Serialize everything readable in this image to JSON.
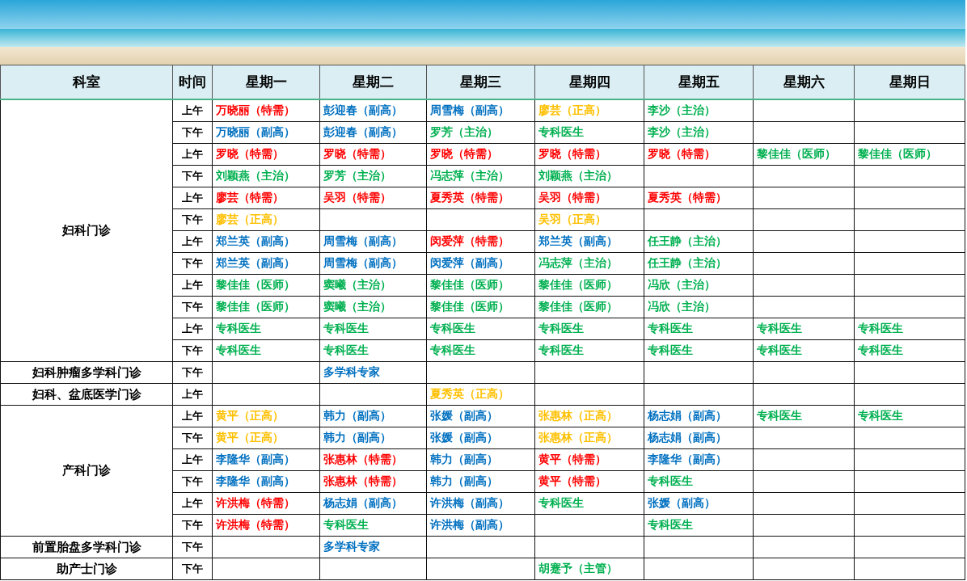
{
  "table": {
    "columns": [
      "科室",
      "时间",
      "星期一",
      "星期二",
      "星期三",
      "星期四",
      "星期五",
      "星期六",
      "星期日"
    ],
    "groups": [
      {
        "department": "妇科门诊",
        "rows": [
          {
            "time": "上午",
            "cells": [
              {
                "text": "万晓丽（特需）",
                "color": "#ff0000"
              },
              {
                "text": "彭迎春（副高）",
                "color": "#0070c0"
              },
              {
                "text": "周雪梅（副高）",
                "color": "#0070c0"
              },
              {
                "text": "廖芸（正高）",
                "color": "#ffc000"
              },
              {
                "text": "李沙（主治）",
                "color": "#00b050"
              },
              null,
              null
            ]
          },
          {
            "time": "下午",
            "cells": [
              {
                "text": "万晓丽（副高）",
                "color": "#0070c0"
              },
              {
                "text": "彭迎春（副高）",
                "color": "#0070c0"
              },
              {
                "text": "罗芳（主治）",
                "color": "#00b050"
              },
              {
                "text": "专科医生",
                "color": "#00b050"
              },
              {
                "text": "李沙（主治）",
                "color": "#00b050"
              },
              null,
              null
            ]
          },
          {
            "time": "上午",
            "cells": [
              {
                "text": "罗晓（特需）",
                "color": "#ff0000"
              },
              {
                "text": "罗晓（特需）",
                "color": "#ff0000"
              },
              {
                "text": "罗晓（特需）",
                "color": "#ff0000"
              },
              {
                "text": "罗晓（特需）",
                "color": "#ff0000"
              },
              {
                "text": "罗晓（特需）",
                "color": "#ff0000"
              },
              {
                "text": "黎佳佳（医师）",
                "color": "#00b050"
              },
              {
                "text": "黎佳佳（医师）",
                "color": "#00b050"
              }
            ]
          },
          {
            "time": "下午",
            "cells": [
              {
                "text": "刘颖燕（主治）",
                "color": "#00b050"
              },
              {
                "text": "罗芳（主治）",
                "color": "#00b050"
              },
              {
                "text": "冯志萍（主治）",
                "color": "#00b050"
              },
              {
                "text": "刘颖燕（主治）",
                "color": "#00b050"
              },
              null,
              null,
              null
            ]
          },
          {
            "time": "上午",
            "cells": [
              {
                "text": "廖芸（特需）",
                "color": "#ff0000"
              },
              {
                "text": "吴羽（特需）",
                "color": "#ff0000"
              },
              {
                "text": "夏秀英（特需）",
                "color": "#ff0000"
              },
              {
                "text": "吴羽（特需）",
                "color": "#ff0000"
              },
              {
                "text": "夏秀英（特需）",
                "color": "#ff0000"
              },
              null,
              null
            ]
          },
          {
            "time": "下午",
            "cells": [
              {
                "text": "廖芸（正高）",
                "color": "#ffc000"
              },
              null,
              null,
              {
                "text": "吴羽（正高）",
                "color": "#ffc000"
              },
              null,
              null,
              null
            ]
          },
          {
            "time": "上午",
            "cells": [
              {
                "text": "郑兰英（副高）",
                "color": "#0070c0"
              },
              {
                "text": "周雪梅（副高）",
                "color": "#0070c0"
              },
              {
                "text": "闵爱萍（特需）",
                "color": "#ff0000"
              },
              {
                "text": "郑兰英（副高）",
                "color": "#0070c0"
              },
              {
                "text": "任王静（主治）",
                "color": "#00b050"
              },
              null,
              null
            ]
          },
          {
            "time": "下午",
            "cells": [
              {
                "text": "郑兰英（副高）",
                "color": "#0070c0"
              },
              {
                "text": "周雪梅（副高）",
                "color": "#0070c0"
              },
              {
                "text": "闵爱萍（副高）",
                "color": "#0070c0"
              },
              {
                "text": "冯志萍（主治）",
                "color": "#00b050"
              },
              {
                "text": "任王静（主治）",
                "color": "#00b050"
              },
              null,
              null
            ]
          },
          {
            "time": "上午",
            "cells": [
              {
                "text": "黎佳佳（医师）",
                "color": "#00b050"
              },
              {
                "text": "窦曦（主治）",
                "color": "#00b050"
              },
              {
                "text": "黎佳佳（医师）",
                "color": "#00b050"
              },
              {
                "text": "黎佳佳（医师）",
                "color": "#00b050"
              },
              {
                "text": "冯欣（主治）",
                "color": "#00b050"
              },
              null,
              null
            ]
          },
          {
            "time": "下午",
            "cells": [
              {
                "text": "黎佳佳（医师）",
                "color": "#00b050"
              },
              {
                "text": "窦曦（主治）",
                "color": "#00b050"
              },
              {
                "text": "黎佳佳（医师）",
                "color": "#00b050"
              },
              {
                "text": "黎佳佳（医师）",
                "color": "#00b050"
              },
              {
                "text": "冯欣（主治）",
                "color": "#00b050"
              },
              null,
              null
            ]
          },
          {
            "time": "上午",
            "cells": [
              {
                "text": "专科医生",
                "color": "#00b050"
              },
              {
                "text": "专科医生",
                "color": "#00b050"
              },
              {
                "text": "专科医生",
                "color": "#00b050"
              },
              {
                "text": "专科医生",
                "color": "#00b050"
              },
              {
                "text": "专科医生",
                "color": "#00b050"
              },
              {
                "text": "专科医生",
                "color": "#00b050"
              },
              {
                "text": "专科医生",
                "color": "#00b050"
              }
            ]
          },
          {
            "time": "下午",
            "cells": [
              {
                "text": "专科医生",
                "color": "#00b050"
              },
              {
                "text": "专科医生",
                "color": "#00b050"
              },
              {
                "text": "专科医生",
                "color": "#00b050"
              },
              {
                "text": "专科医生",
                "color": "#00b050"
              },
              {
                "text": "专科医生",
                "color": "#00b050"
              },
              {
                "text": "专科医生",
                "color": "#00b050"
              },
              {
                "text": "专科医生",
                "color": "#00b050"
              }
            ]
          }
        ]
      },
      {
        "department": "妇科肿瘤多学科门诊",
        "rows": [
          {
            "time": "下午",
            "cells": [
              null,
              {
                "text": "多学科专家",
                "color": "#0070c0"
              },
              null,
              null,
              null,
              null,
              null
            ]
          }
        ]
      },
      {
        "department": "妇科、盆底医学门诊",
        "rows": [
          {
            "time": "上午",
            "cells": [
              null,
              null,
              {
                "text": "夏秀英（正高）",
                "color": "#ffc000"
              },
              null,
              null,
              null,
              null
            ]
          }
        ]
      },
      {
        "department": "产科门诊",
        "rows": [
          {
            "time": "上午",
            "cells": [
              {
                "text": "黄平（正高）",
                "color": "#ffc000"
              },
              {
                "text": "韩力（副高）",
                "color": "#0070c0"
              },
              {
                "text": "张媛（副高）",
                "color": "#0070c0"
              },
              {
                "text": "张惠林（正高）",
                "color": "#ffc000"
              },
              {
                "text": "杨志娟（副高）",
                "color": "#0070c0"
              },
              {
                "text": "专科医生",
                "color": "#00b050"
              },
              {
                "text": "专科医生",
                "color": "#00b050"
              }
            ]
          },
          {
            "time": "下午",
            "cells": [
              {
                "text": "黄平（正高）",
                "color": "#ffc000"
              },
              {
                "text": "韩力（副高）",
                "color": "#0070c0"
              },
              {
                "text": "张媛（副高）",
                "color": "#0070c0"
              },
              {
                "text": "张惠林（正高）",
                "color": "#ffc000"
              },
              {
                "text": "杨志娟（副高）",
                "color": "#0070c0"
              },
              null,
              null
            ]
          },
          {
            "time": "上午",
            "cells": [
              {
                "text": "李隆华（副高）",
                "color": "#0070c0"
              },
              {
                "text": "张惠林（特需）",
                "color": "#ff0000"
              },
              {
                "text": "韩力（副高）",
                "color": "#0070c0"
              },
              {
                "text": "黄平（特需）",
                "color": "#ff0000"
              },
              {
                "text": "李隆华（副高）",
                "color": "#0070c0"
              },
              null,
              null
            ]
          },
          {
            "time": "下午",
            "cells": [
              {
                "text": "李隆华（副高）",
                "color": "#0070c0"
              },
              {
                "text": "张惠林（特需）",
                "color": "#ff0000"
              },
              {
                "text": "韩力（副高）",
                "color": "#0070c0"
              },
              {
                "text": "黄平（特需）",
                "color": "#ff0000"
              },
              {
                "text": "专科医生",
                "color": "#00b050"
              },
              null,
              null
            ]
          },
          {
            "time": "上午",
            "cells": [
              {
                "text": "许洪梅（特需）",
                "color": "#ff0000"
              },
              {
                "text": "杨志娟（副高）",
                "color": "#0070c0"
              },
              {
                "text": "许洪梅（副高）",
                "color": "#0070c0"
              },
              {
                "text": "专科医生",
                "color": "#00b050"
              },
              {
                "text": "张媛（副高）",
                "color": "#0070c0"
              },
              null,
              null
            ]
          },
          {
            "time": "下午",
            "cells": [
              {
                "text": "许洪梅（特需）",
                "color": "#ff0000"
              },
              {
                "text": "专科医生",
                "color": "#00b050"
              },
              {
                "text": "许洪梅（副高）",
                "color": "#0070c0"
              },
              null,
              {
                "text": "专科医生",
                "color": "#00b050"
              },
              null,
              null
            ]
          }
        ]
      },
      {
        "department": "前置胎盘多学科门诊",
        "rows": [
          {
            "time": "下午",
            "cells": [
              null,
              {
                "text": "多学科专家",
                "color": "#0070c0"
              },
              null,
              null,
              null,
              null,
              null
            ]
          }
        ]
      },
      {
        "department": "助产士门诊",
        "rows": [
          {
            "time": "下午",
            "cells": [
              null,
              null,
              null,
              {
                "text": "胡蹇予（主管）",
                "color": "#00b050"
              },
              null,
              null,
              null
            ]
          }
        ]
      }
    ]
  }
}
